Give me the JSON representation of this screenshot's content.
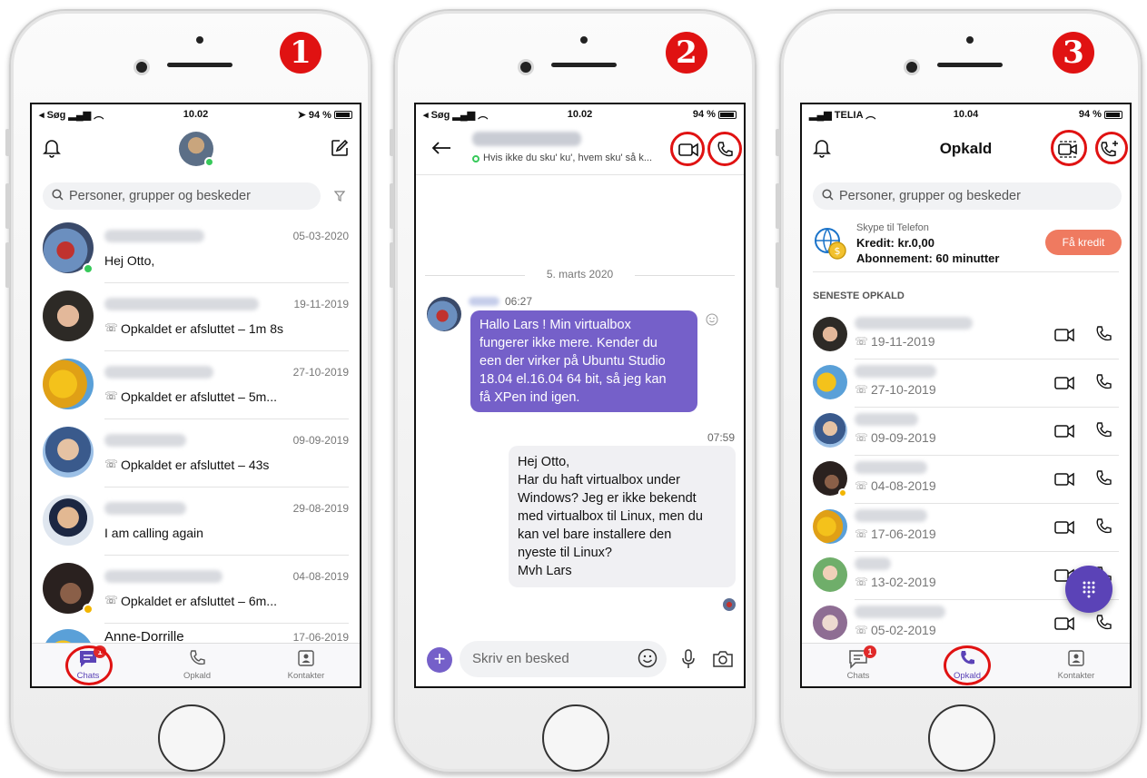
{
  "markers": [
    "1",
    "2",
    "3"
  ],
  "colors": {
    "accent": "#5b43b7",
    "highlight": "#e01212",
    "bubble_in": "#7560c9",
    "kredit": "#ef7a60"
  },
  "phone1": {
    "status": {
      "left": "◂ Søg",
      "time": "10.02",
      "battery": "94 %"
    },
    "search_placeholder": "Personer, grupper og beskeder",
    "chats": [
      {
        "date": "05-03-2020",
        "preview": "Hej Otto,"
      },
      {
        "date": "19-11-2019",
        "preview": "Opkaldet er afsluttet – 1m 8s"
      },
      {
        "date": "27-10-2019",
        "preview": "Opkaldet er afsluttet – 5m..."
      },
      {
        "date": "09-09-2019",
        "preview": "Opkaldet er afsluttet – 43s"
      },
      {
        "date": "29-08-2019",
        "preview": "I am calling again"
      },
      {
        "date": "04-08-2019",
        "preview": "Opkaldet er afsluttet – 6m..."
      },
      {
        "name": "Anne-Dorrille",
        "date": "17-06-2019"
      }
    ],
    "tabs": {
      "chats": "Chats",
      "chats_badge": "1",
      "calls": "Opkald",
      "contacts": "Kontakter"
    }
  },
  "phone2": {
    "status": {
      "left": "◂ Søg",
      "time": "10.02",
      "battery": "94 %"
    },
    "mood": "Hvis ikke du sku'  ku', hvem sku' så k...",
    "date_separator": "5. marts 2020",
    "incoming_time": "06:27",
    "incoming_lines": [
      "Hallo Lars !  Min virtualbox",
      "fungerer ikke mere. Kender du",
      "een der virker på Ubuntu Studio",
      "18.04 el.16.04 64 bit, så jeg kan",
      "få XPen ind igen."
    ],
    "outgoing_time": "07:59",
    "outgoing_lines": [
      "Hej Otto,",
      "Har du haft virtualbox under",
      "Windows? Jeg er ikke bekendt",
      "med virtualbox til Linux, men du",
      "kan vel bare installere den",
      "nyeste til Linux?",
      "Mvh Lars"
    ],
    "composer_placeholder": "Skriv en besked"
  },
  "phone3": {
    "status": {
      "left": "TELIA",
      "time": "10.04",
      "battery": "94 %"
    },
    "title": "Opkald",
    "search_placeholder": "Personer, grupper og beskeder",
    "skype_label": "Skype til Telefon",
    "credit": "Kredit: kr.0,00",
    "subscription": "Abonnement: 60 minutter",
    "get_credit": "Få kredit",
    "section": "SENESTE OPKALD",
    "calls": [
      "19-11-2019",
      "27-10-2019",
      "09-09-2019",
      "04-08-2019",
      "17-06-2019",
      "13-02-2019",
      "05-02-2019"
    ],
    "tabs": {
      "chats": "Chats",
      "chats_badge": "1",
      "calls": "Opkald",
      "contacts": "Kontakter"
    }
  }
}
